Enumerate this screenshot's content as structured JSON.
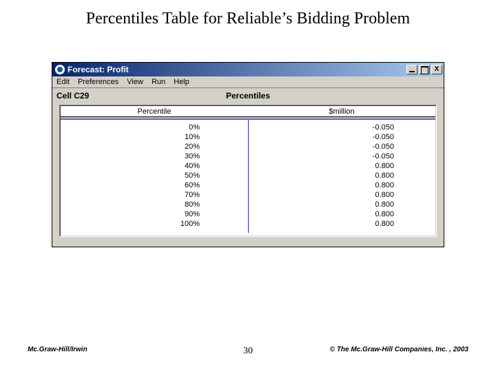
{
  "slide": {
    "title": "Percentiles Table for Reliable’s Bidding Problem"
  },
  "window": {
    "title": "Forecast: Profit",
    "controls": {
      "min": "_",
      "max": "□",
      "close": "X"
    }
  },
  "menubar": [
    "Edit",
    "Preferences",
    "View",
    "Run",
    "Help"
  ],
  "header": {
    "cell_label": "Cell C29",
    "table_title": "Percentiles"
  },
  "table": {
    "columns": [
      "Percentile",
      "$million"
    ],
    "rows": [
      {
        "percentile": "0%",
        "value": "-0.050"
      },
      {
        "percentile": "10%",
        "value": "-0.050"
      },
      {
        "percentile": "20%",
        "value": "-0.050"
      },
      {
        "percentile": "30%",
        "value": "-0.050"
      },
      {
        "percentile": "40%",
        "value": "0.800"
      },
      {
        "percentile": "50%",
        "value": "0.800"
      },
      {
        "percentile": "60%",
        "value": "0.800"
      },
      {
        "percentile": "70%",
        "value": "0.800"
      },
      {
        "percentile": "80%",
        "value": "0.800"
      },
      {
        "percentile": "90%",
        "value": "0.800"
      },
      {
        "percentile": "100%",
        "value": "0.800"
      }
    ]
  },
  "footer": {
    "left": "Mc.Graw-Hill/Irwin",
    "page": "30",
    "right": "© The Mc.Graw-Hill Companies, Inc. , 2003"
  },
  "chart_data": {
    "type": "table",
    "title": "Percentiles",
    "columns": [
      "Percentile",
      "$million"
    ],
    "rows": [
      [
        0,
        -0.05
      ],
      [
        10,
        -0.05
      ],
      [
        20,
        -0.05
      ],
      [
        30,
        -0.05
      ],
      [
        40,
        0.8
      ],
      [
        50,
        0.8
      ],
      [
        60,
        0.8
      ],
      [
        70,
        0.8
      ],
      [
        80,
        0.8
      ],
      [
        90,
        0.8
      ],
      [
        100,
        0.8
      ]
    ]
  }
}
